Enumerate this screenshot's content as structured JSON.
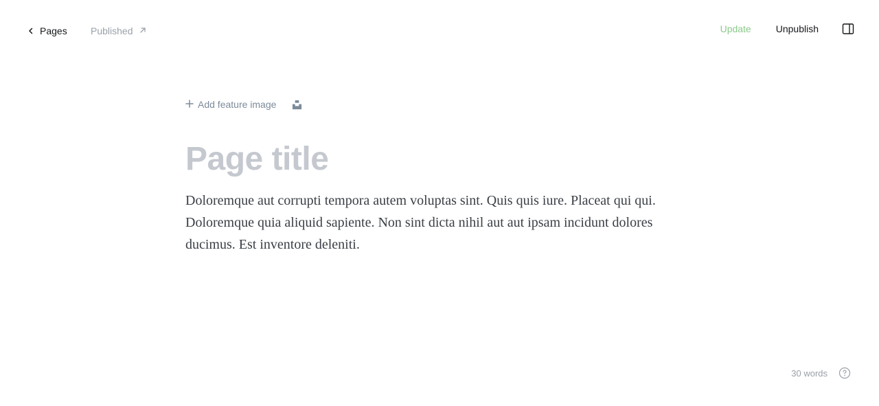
{
  "header": {
    "back_label": "Pages",
    "status_label": "Published",
    "update_label": "Update",
    "unpublish_label": "Unpublish"
  },
  "editor": {
    "add_feature_image_label": "Add feature image",
    "title_placeholder": "Page title",
    "body": "Doloremque aut corrupti tempora autem voluptas sint. Quis quis iure. Placeat qui qui. Doloremque quia aliquid sapiente. Non sint dicta nihil aut aut ipsam incidunt dolores ducimus. Est inventore deleniti."
  },
  "footer": {
    "word_count": "30 words"
  },
  "colors": {
    "update_accent": "#8cc98c",
    "title_placeholder": "#c5c9cf",
    "muted": "#9aa0a8"
  },
  "icons": [
    "chevron-left-icon",
    "arrow-up-right-icon",
    "sidebar-toggle-icon",
    "plus-icon",
    "unsplash-icon",
    "help-icon"
  ]
}
